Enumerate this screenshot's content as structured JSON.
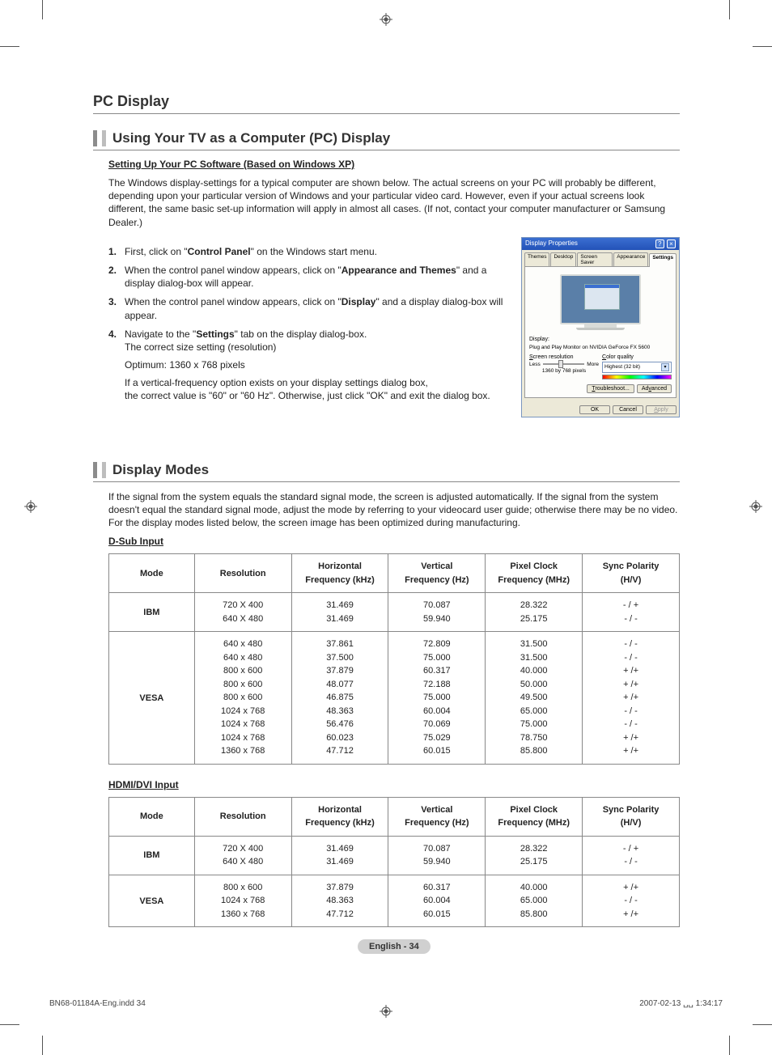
{
  "section_title": "PC Display",
  "sub1_title": "Using Your TV as a Computer (PC) Display",
  "setup_link": "Setting Up Your PC Software (Based on Windows XP)",
  "intro_para": "The Windows display-settings for a typical computer are shown below. The actual screens on your PC will probably be different, depending upon your particular version of Windows and your particular video card. However, even if your actual screens look different, the same basic set-up information will apply in almost all cases. (If not, contact your computer manufacturer or Samsung Dealer.)",
  "step1_pre": "First, click on \"",
  "step1_bold": "Control Panel",
  "step1_post": "\" on the Windows start menu.",
  "step2_pre": "When the control panel window appears, click on \"",
  "step2_bold": "Appearance and Themes",
  "step2_post": "\" and a display dialog-box will appear.",
  "step3_pre": "When the control panel window appears, click on \"",
  "step3_bold": "Display",
  "step3_post": "\" and a display dialog-box will appear.",
  "step4_pre": "Navigate to the \"",
  "step4_bold": "Settings",
  "step4_post": "\" tab on the display dialog-box.",
  "step4_line2": "The correct size setting (resolution)",
  "optimum": "Optimum: 1360 x 768 pixels",
  "vfreq_note": "If a vertical-frequency option exists on your display settings dialog box,\nthe correct value is \"60\" or \"60 Hz\". Otherwise, just click \"OK\" and exit the dialog box.",
  "dlg": {
    "title": "Display Properties",
    "tabs": [
      "Themes",
      "Desktop",
      "Screen Saver",
      "Appearance",
      "Settings"
    ],
    "display_label": "Display:",
    "display_val": "Plug and Play Monitor on NVIDIA GeForce FX 5600",
    "res_label_u": "S",
    "res_label_rest": "creen resolution",
    "res_less": "Less",
    "res_more": "More",
    "res_val": "1360 by 768 pixels",
    "cq_label_u": "C",
    "cq_label_rest": "olor quality",
    "cq_val": "Highest (32 bit)",
    "btn_tshoot_u": "T",
    "btn_tshoot_rest": "roubleshoot...",
    "btn_adv_u": "v",
    "btn_adv_pre": "Ad",
    "btn_adv_rest": "anced",
    "btn_ok": "OK",
    "btn_cancel": "Cancel",
    "btn_apply_u": "A",
    "btn_apply_rest": "pply"
  },
  "sub2_title": "Display Modes",
  "modes_intro": "If the signal from the system equals the standard signal mode, the screen is adjusted automatically.  If the signal from the system doesn't equal the standard signal mode, adjust the mode by referring to your videocard user guide; otherwise there may be no video. For the display modes listed below, the screen image has been optimized during manufacturing.",
  "table1_label": "D-Sub Input",
  "table2_label": "HDMI/DVI Input",
  "th": {
    "mode": "Mode",
    "res": "Resolution",
    "hf": "Horizontal\nFrequency (kHz)",
    "vf": "Vertical\nFrequency (Hz)",
    "pc": "Pixel Clock\nFrequency (MHz)",
    "sp": "Sync Polarity\n(H/V)"
  },
  "chart_data": [
    {
      "type": "table",
      "title": "D-Sub Input",
      "columns": [
        "Mode",
        "Resolution",
        "Horizontal Frequency (kHz)",
        "Vertical Frequency (Hz)",
        "Pixel Clock Frequency (MHz)",
        "Sync Polarity (H/V)"
      ],
      "rows": [
        {
          "mode": "IBM",
          "resolution": "720 X 400",
          "hf": 31.469,
          "vf": 70.087,
          "pc": 28.322,
          "sp": "- / +"
        },
        {
          "mode": "IBM",
          "resolution": "640 X 480",
          "hf": 31.469,
          "vf": 59.94,
          "pc": 25.175,
          "sp": "- / -"
        },
        {
          "mode": "VESA",
          "resolution": "640 x 480",
          "hf": 37.861,
          "vf": 72.809,
          "pc": 31.5,
          "sp": "- / -"
        },
        {
          "mode": "VESA",
          "resolution": "640 x 480",
          "hf": 37.5,
          "vf": 75.0,
          "pc": 31.5,
          "sp": "- / -"
        },
        {
          "mode": "VESA",
          "resolution": "800 x 600",
          "hf": 37.879,
          "vf": 60.317,
          "pc": 40.0,
          "sp": "+ /+"
        },
        {
          "mode": "VESA",
          "resolution": "800 x 600",
          "hf": 48.077,
          "vf": 72.188,
          "pc": 50.0,
          "sp": "+ /+"
        },
        {
          "mode": "VESA",
          "resolution": "800 x 600",
          "hf": 46.875,
          "vf": 75.0,
          "pc": 49.5,
          "sp": "+ /+"
        },
        {
          "mode": "VESA",
          "resolution": "1024 x 768",
          "hf": 48.363,
          "vf": 60.004,
          "pc": 65.0,
          "sp": "- / -"
        },
        {
          "mode": "VESA",
          "resolution": "1024 x 768",
          "hf": 56.476,
          "vf": 70.069,
          "pc": 75.0,
          "sp": "- / -"
        },
        {
          "mode": "VESA",
          "resolution": "1024 x 768",
          "hf": 60.023,
          "vf": 75.029,
          "pc": 78.75,
          "sp": "+ /+"
        },
        {
          "mode": "VESA",
          "resolution": "1360 x 768",
          "hf": 47.712,
          "vf": 60.015,
          "pc": 85.8,
          "sp": "+ /+"
        }
      ]
    },
    {
      "type": "table",
      "title": "HDMI/DVI Input",
      "columns": [
        "Mode",
        "Resolution",
        "Horizontal Frequency (kHz)",
        "Vertical Frequency (Hz)",
        "Pixel Clock Frequency (MHz)",
        "Sync Polarity (H/V)"
      ],
      "rows": [
        {
          "mode": "IBM",
          "resolution": "720 X 400",
          "hf": 31.469,
          "vf": 70.087,
          "pc": 28.322,
          "sp": "- / +"
        },
        {
          "mode": "IBM",
          "resolution": "640 X 480",
          "hf": 31.469,
          "vf": 59.94,
          "pc": 25.175,
          "sp": "- / -"
        },
        {
          "mode": "VESA",
          "resolution": "800 x 600",
          "hf": 37.879,
          "vf": 60.317,
          "pc": 40.0,
          "sp": "+ /+"
        },
        {
          "mode": "VESA",
          "resolution": "1024 x 768",
          "hf": 48.363,
          "vf": 60.004,
          "pc": 65.0,
          "sp": "- / -"
        },
        {
          "mode": "VESA",
          "resolution": "1360 x 768",
          "hf": 47.712,
          "vf": 60.015,
          "pc": 85.8,
          "sp": "+ /+"
        }
      ]
    }
  ],
  "t1": {
    "ibm_res": "720 X 400\n640 X 480",
    "ibm_hf": "31.469\n31.469",
    "ibm_vf": "70.087\n59.940",
    "ibm_pc": "28.322\n25.175",
    "ibm_sp": "- / +\n- / -",
    "vesa_res": "640 x 480\n640 x 480\n800 x 600\n800 x 600\n800 x 600\n1024 x 768\n1024 x 768\n1024 x 768\n1360 x 768",
    "vesa_hf": "37.861\n37.500\n37.879\n48.077\n46.875\n48.363\n56.476\n60.023\n47.712",
    "vesa_vf": "72.809\n75.000\n60.317\n72.188\n75.000\n60.004\n70.069\n75.029\n60.015",
    "vesa_pc": "31.500\n31.500\n40.000\n50.000\n49.500\n65.000\n75.000\n78.750\n85.800",
    "vesa_sp": "- / -\n- / -\n+ /+\n+ /+\n+ /+\n- / -\n- / -\n+ /+\n+ /+"
  },
  "t2": {
    "ibm_res": "720 X 400\n640 X 480",
    "ibm_hf": "31.469\n31.469",
    "ibm_vf": "70.087\n59.940",
    "ibm_pc": "28.322\n25.175",
    "ibm_sp": "- / +\n- / -",
    "vesa_res": "800 x 600\n1024 x 768\n1360 x 768",
    "vesa_hf": "37.879\n48.363\n47.712",
    "vesa_vf": "60.317\n60.004\n60.015",
    "vesa_pc": "40.000\n65.000\n85.800",
    "vesa_sp": "+ /+\n- / -\n+ /+"
  },
  "mode_ibm": "IBM",
  "mode_vesa": "VESA",
  "page_badge": "English - 34",
  "footer_left": "BN68-01184A-Eng.indd   34",
  "footer_right": "2007-02-13   ␣␣ 1:34:17"
}
